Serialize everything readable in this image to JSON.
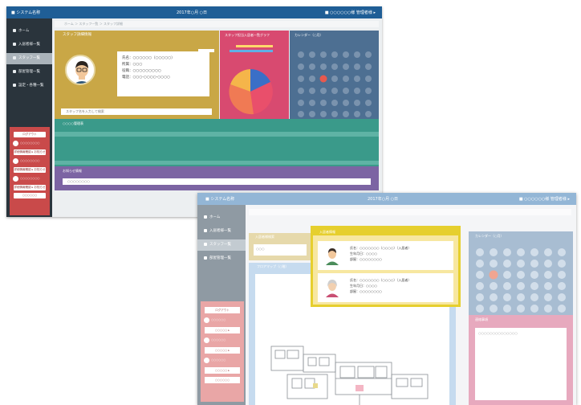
{
  "window_a": {
    "app_title": "■ システム名称",
    "date": "2017年○月 ○日",
    "user": "■ ○○○○○○様 管理者様 ▸",
    "sidebar": {
      "items": [
        {
          "label": "ホーム",
          "icon": "home-icon"
        },
        {
          "label": "入居者様一覧",
          "icon": "user-icon"
        },
        {
          "label": "スタッフ一覧",
          "icon": "staff-icon",
          "active": true
        },
        {
          "label": "部屋管理一覧",
          "icon": "room-icon"
        },
        {
          "label": "設定・各種一覧",
          "icon": "settings-icon"
        }
      ]
    },
    "red_panel": {
      "top_button": "ログアウト",
      "rows": [
        {
          "label": "○○○○○○○○",
          "button": "詳細情報確認 ▸ お知らせ"
        },
        {
          "label": "○○○○○○○○",
          "button": "詳細情報確認 ▸ お知らせ"
        },
        {
          "label": "○○○○○○○○",
          "button": "詳細情報確認 ▸ お知らせ"
        }
      ],
      "bottom_button": "○○○○○○"
    },
    "breadcrumb": "ホーム ＞ スタッフ一覧 ＞ スタッフ詳細",
    "staff_card": {
      "header": "スタッフ詳細情報",
      "info_lines": [
        "氏名：○○○○○○（○○○○○）",
        "所属：○○○",
        "役職：○○○○○○○○○",
        "電話：○○○-○○○○-○○○○"
      ],
      "search_text": "スタッフ名を入力して検索"
    },
    "chart_card": {
      "header": "スタッフ担当入居者一覧グラフ"
    },
    "calendar_card": {
      "header": "カレンダー（○月）"
    },
    "teal_panel": {
      "header": "○○○○管理表"
    },
    "purple_panel": {
      "header": "お知らせ情報",
      "input": "○○○○○○○○"
    },
    "colors": {
      "topbar": "#1f5e96",
      "sidebar": "#2a343c",
      "staff": "#c9a746",
      "chart": "#d84a70",
      "calendar": "#4d6f92",
      "teal": "#3a9a8a",
      "purple": "#7c64a3",
      "red": "#c94a4a"
    }
  },
  "window_b": {
    "app_title": "■ システム名称",
    "date": "2017年○月 ○日",
    "user": "■ ○○○○○○様 管理者様 ▸",
    "sidebar": {
      "items": [
        {
          "label": "ホーム",
          "icon": "home-icon"
        },
        {
          "label": "入居者様一覧",
          "icon": "user-icon"
        },
        {
          "label": "スタッフ一覧",
          "icon": "staff-icon",
          "active": true
        },
        {
          "label": "部屋管理一覧",
          "icon": "room-icon"
        }
      ]
    },
    "red_panel": {
      "top_button": "ログアウト",
      "rows": [
        {
          "label": "○○○○○○",
          "button": "○○○○○ ▸"
        },
        {
          "label": "○○○○○○",
          "button": "○○○○○ ▸"
        },
        {
          "label": "○○○○○○",
          "button": "○○○○○ ▸"
        }
      ],
      "bottom_button": "○○○○○○"
    },
    "tan_card": {
      "header": "入居者様検索",
      "input": "○○○"
    },
    "floor_card": {
      "header": "フロアマップ（○階）"
    },
    "calendar_card": {
      "header": "カレンダー（○月）"
    },
    "pink_card": {
      "header": "連絡事項",
      "input": "○○○○○○○○○○○○○○"
    },
    "colors": {
      "topbar": "#93b6d6",
      "sidebar": "#8f9aa3",
      "floor": "#c6dbef",
      "calendar": "#a8bdd2",
      "pink": "#e7a9be",
      "red": "#e9a6a6"
    }
  },
  "popup": {
    "header": "入居者情報",
    "entries": [
      {
        "icon": "male-avatar-icon",
        "lines": [
          "氏名：○○○○○○○（○○○○）（入居者）",
          "生年月日：○○○○",
          "部屋：○○○○○○○○"
        ]
      },
      {
        "icon": "female-avatar-icon",
        "lines": [
          "氏名：○○○○○○○（○○○○）（入居者）",
          "生年月日：○○○○",
          "部屋：○○○○○○○○"
        ]
      }
    ],
    "colors": {
      "frame": "#e6cf2e",
      "fill": "#f7e7a0"
    }
  }
}
